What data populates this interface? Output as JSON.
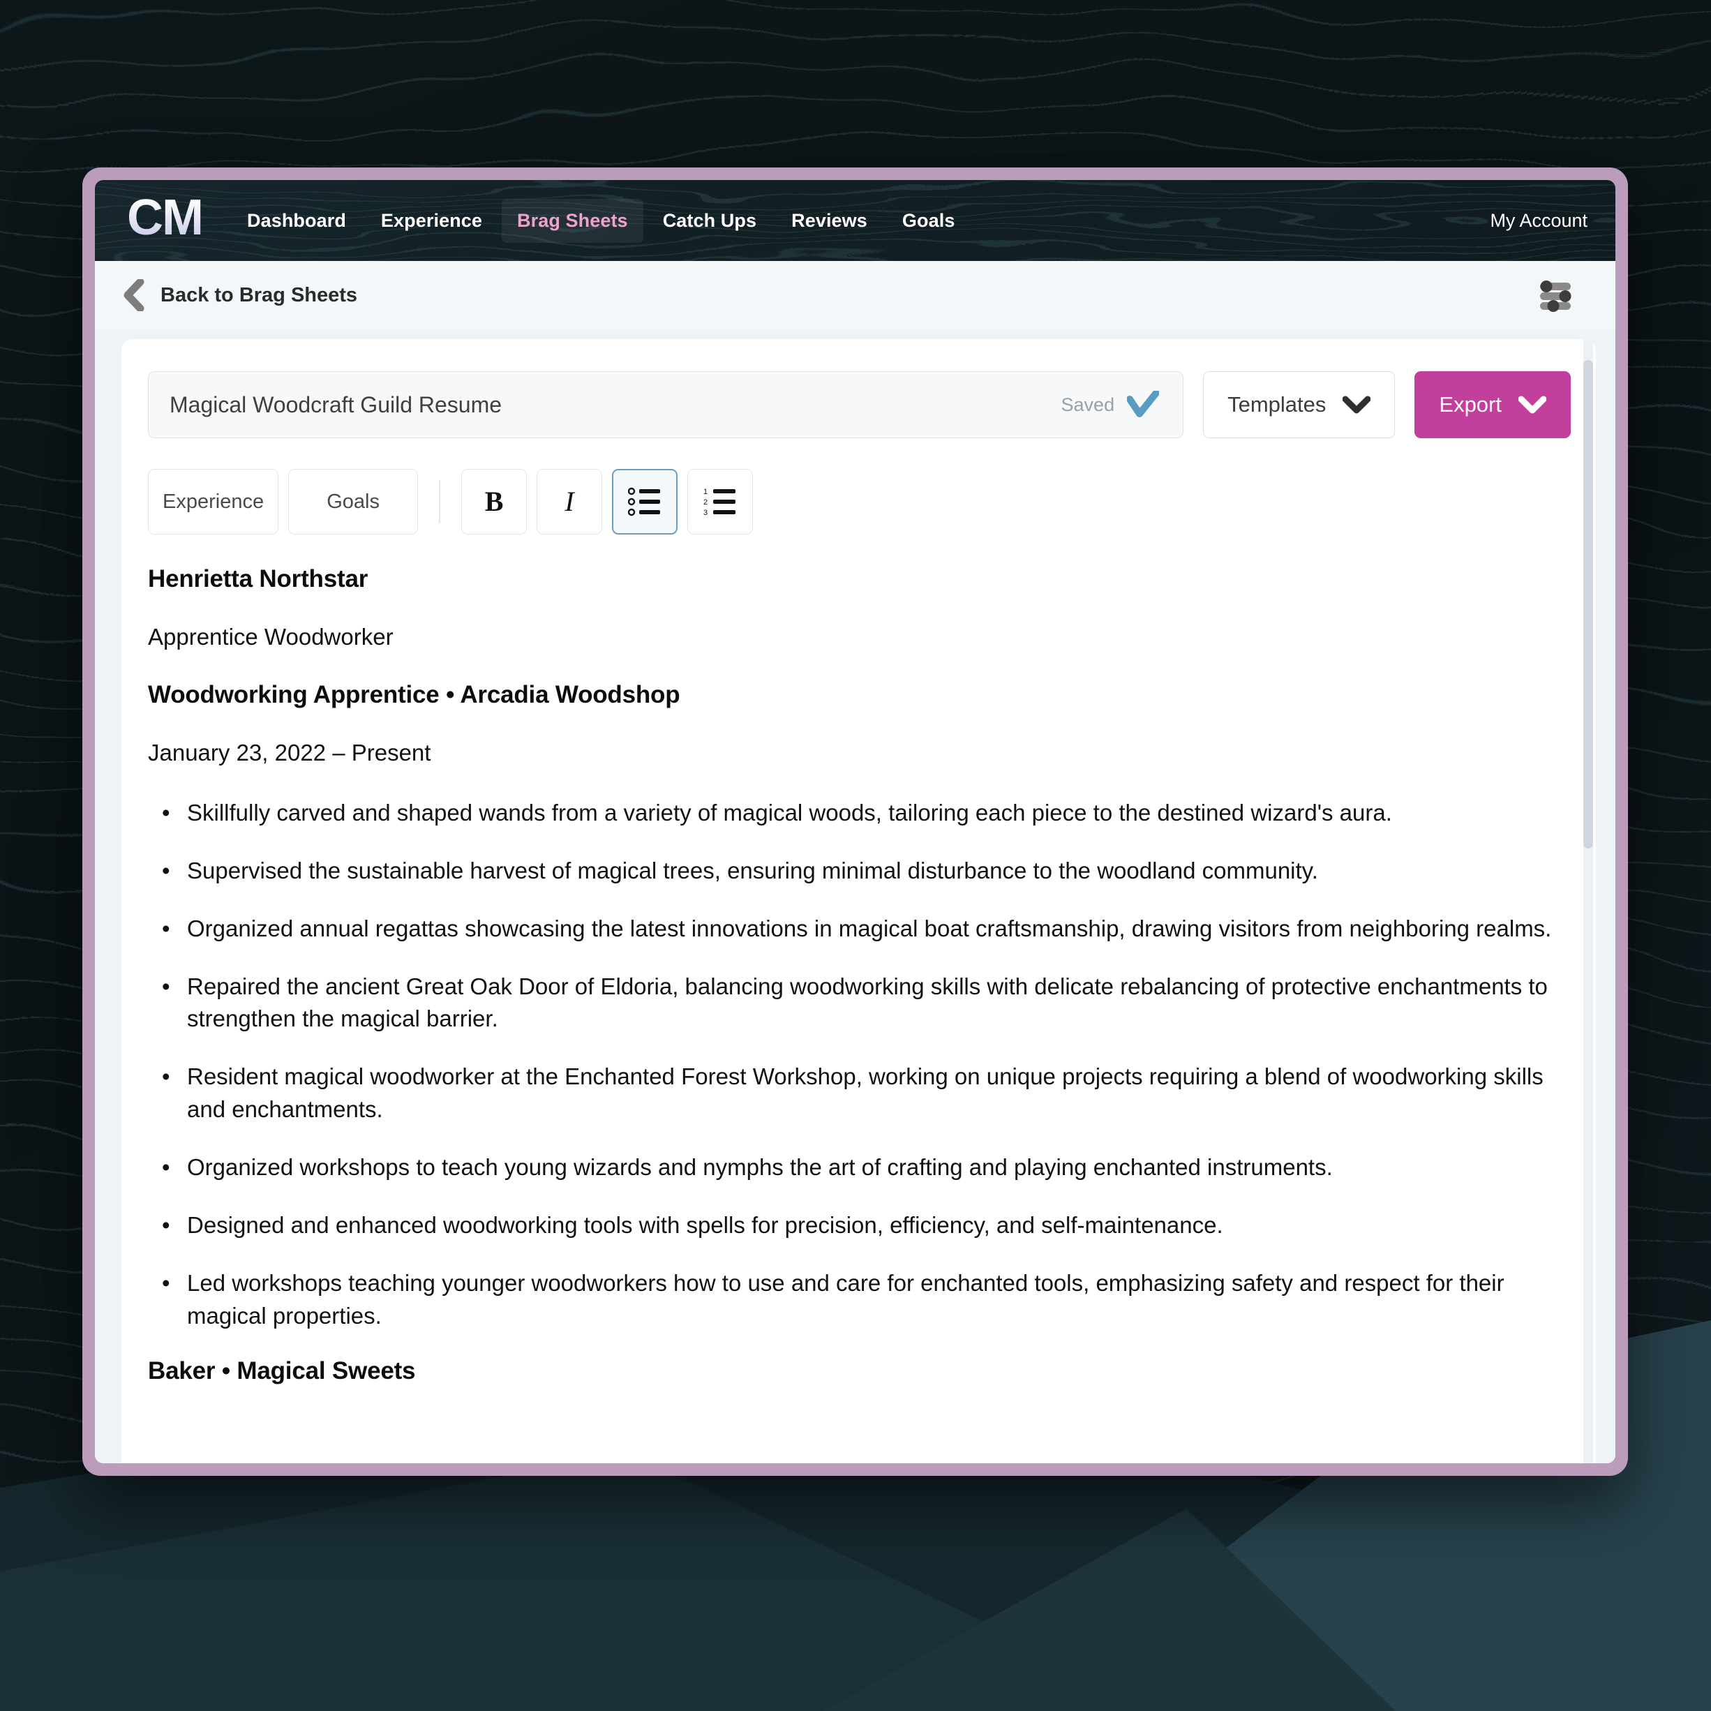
{
  "theme": {
    "window_border": "#bb9dbb",
    "nav_bg": "#122025",
    "active_tab_text": "#eda3cd",
    "accent_export": "#c23f9b",
    "active_tool_border": "#6b9fc0",
    "page_bg": "#eef3f7",
    "card_bg": "#ffffff",
    "saved_check": "#5a9bc4"
  },
  "nav": {
    "logo": "CM",
    "items": [
      {
        "label": "Dashboard",
        "active": false
      },
      {
        "label": "Experience",
        "active": false
      },
      {
        "label": "Brag Sheets",
        "active": true
      },
      {
        "label": "Catch Ups",
        "active": false
      },
      {
        "label": "Reviews",
        "active": false
      },
      {
        "label": "Goals",
        "active": false
      }
    ],
    "account_label": "My Account"
  },
  "subheader": {
    "back_label": "Back to Brag Sheets",
    "back_icon": "chevron-left-icon",
    "settings_icon": "sliders-icon"
  },
  "title_row": {
    "value": "Magical Woodcraft Guild Resume",
    "placeholder": "Brag sheet title",
    "status_label": "Saved",
    "status_icon": "checkmark-icon",
    "templates_label": "Templates",
    "templates_icon": "chevron-down-icon",
    "export_label": "Export",
    "export_icon": "chevron-down-icon"
  },
  "toolbar": {
    "tabs": [
      {
        "label": "Experience",
        "active": false
      },
      {
        "label": "Goals",
        "active": false
      }
    ],
    "format_buttons": [
      {
        "name": "bold-button",
        "glyph": "B",
        "style": "bold",
        "active": false
      },
      {
        "name": "italic-button",
        "glyph": "I",
        "style": "italic",
        "active": false
      },
      {
        "name": "bulleted-list-button",
        "glyph": "",
        "style": "icon-bullet-list",
        "active": true
      },
      {
        "name": "numbered-list-button",
        "glyph": "",
        "style": "icon-numbered-list",
        "active": false
      }
    ]
  },
  "document": {
    "name": "Henrietta Northstar",
    "role": "Apprentice Woodworker",
    "job_heading": "Woodworking Apprentice • Arcadia Woodshop",
    "job_dates": "January 23, 2022 – Present",
    "bullets": [
      "Skillfully carved and shaped wands from a variety of magical woods, tailoring each piece to the destined wizard's aura.",
      "Supervised the sustainable harvest of magical trees, ensuring minimal disturbance to the woodland community.",
      "Organized annual regattas showcasing the latest innovations in magical boat craftsmanship, drawing visitors from neighboring realms.",
      "Repaired the ancient Great Oak Door of Eldoria, balancing woodworking skills with delicate rebalancing of protective enchantments to strengthen the magical barrier.",
      "Resident magical woodworker at the Enchanted Forest Workshop, working on unique projects requiring a blend of woodworking skills and enchantments.",
      "Organized workshops to teach young wizards and nymphs the art of crafting and playing enchanted instruments.",
      "Designed and enhanced woodworking tools with spells for precision, efficiency, and self-maintenance.",
      "Led workshops teaching younger woodworkers how to use and care for enchanted tools, emphasizing safety and respect for their magical properties."
    ],
    "next_job_heading": "Baker • Magical Sweets"
  }
}
